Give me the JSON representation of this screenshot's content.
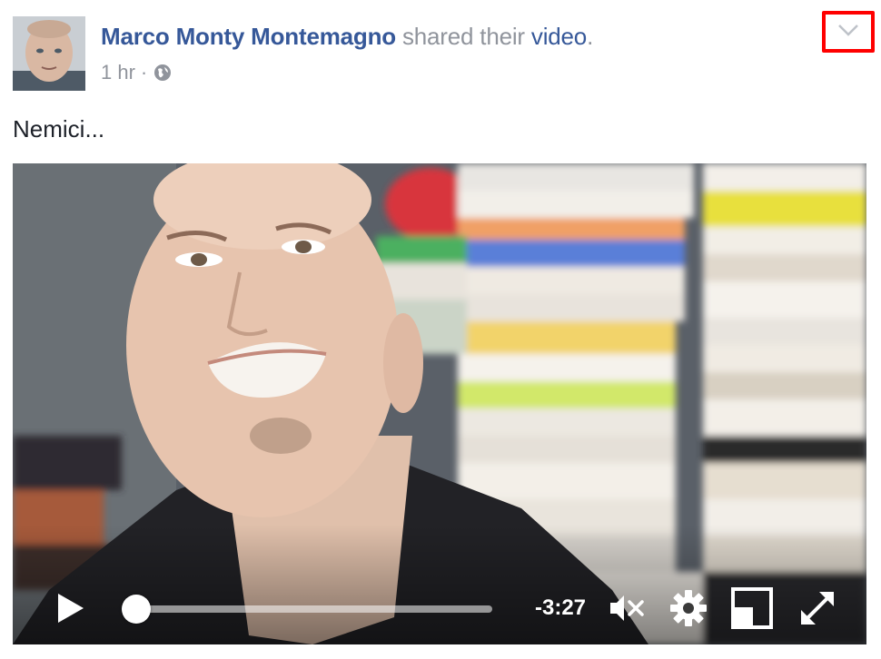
{
  "post": {
    "author_name": "Marco Monty Montemagno",
    "action_text": "shared their",
    "object_link": "video",
    "period": ".",
    "timestamp": "1 hr",
    "separator": "·",
    "privacy_icon": "globe-icon",
    "menu_icon": "chevron-down-icon",
    "text": "Nemici..."
  },
  "video": {
    "time_remaining": "-3:27",
    "progress": 0.04,
    "icons": [
      "play-icon",
      "mute-icon",
      "gear-icon",
      "pip-icon",
      "fullscreen-icon"
    ]
  },
  "colors": {
    "link": "#365899",
    "muted": "#90949c",
    "highlight": "#ff0000",
    "progress": "#4267b2"
  }
}
